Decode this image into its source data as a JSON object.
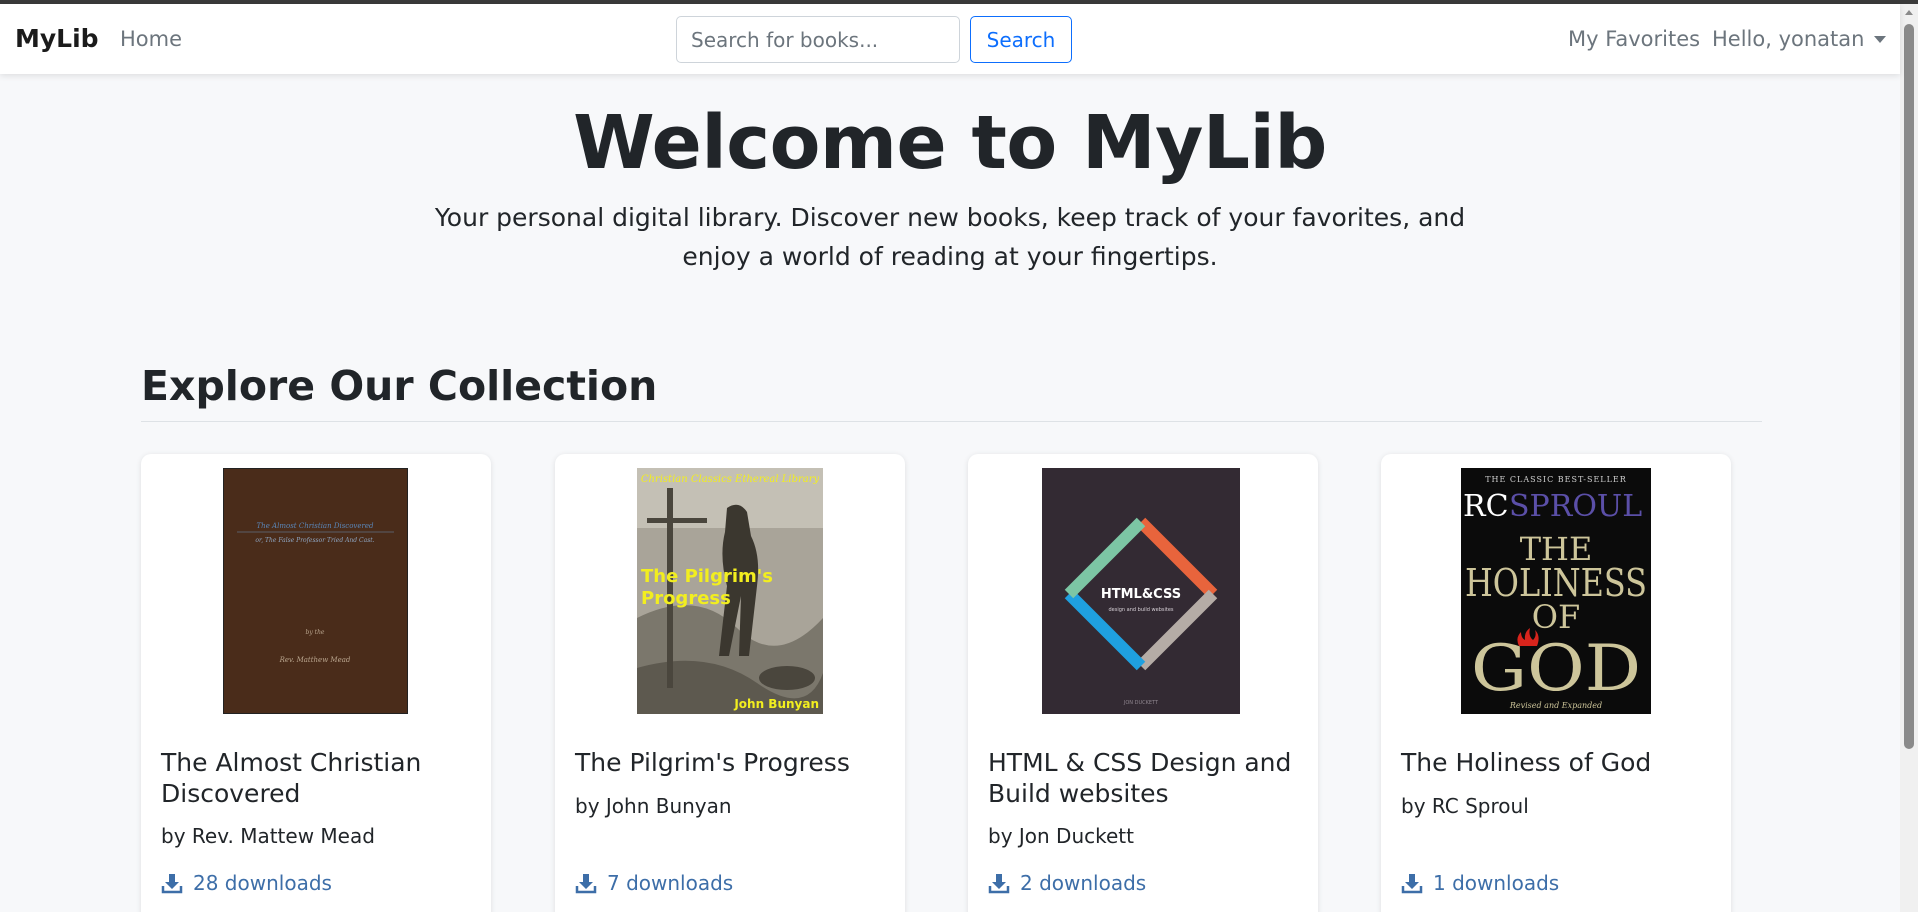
{
  "navbar": {
    "brand": "MyLib",
    "home_label": "Home",
    "search_placeholder": "Search for books...",
    "search_button": "Search",
    "favorites_label": "My Favorites",
    "user_greeting": "Hello, yonatan"
  },
  "hero": {
    "title": "Welcome to MyLib",
    "subtitle": "Your personal digital library. Discover new books, keep track of your favorites, and enjoy a world of reading at your fingertips."
  },
  "collection": {
    "heading": "Explore Our Collection",
    "books": [
      {
        "title": "The Almost Christian Discovered",
        "author": "by Rev. Mattew Mead",
        "downloads": "28 downloads",
        "cover": {
          "line1": "The Almost Christian Discovered",
          "line2": "or, The False Professor Tried And Cast.",
          "byline": "by the",
          "name": "Rev. Matthew Mead",
          "bg": "#4a2c1a"
        }
      },
      {
        "title": "The Pilgrim's Progress",
        "author": "by John Bunyan",
        "downloads": "7 downloads",
        "cover": {
          "series": "Christian Classics Ethereal Library",
          "title": "The Pilgrim's Progress",
          "author": "John Bunyan",
          "text_color": "#f2ee1f"
        }
      },
      {
        "title": "HTML & CSS Design and Build websites",
        "author": "by Jon Duckett",
        "downloads": "2 downloads",
        "cover": {
          "title_a": "HTML",
          "amp": "&",
          "title_b": "CSS",
          "subtitle": "design and build websites",
          "author": "JON DUCKETT",
          "bg": "#332a33"
        }
      },
      {
        "title": "The Holiness of God",
        "author": "by RC Sproul",
        "downloads": "1 downloads",
        "cover": {
          "top": "THE CLASSIC BEST-SELLER",
          "author_a": "RC",
          "author_b": "SPROUL",
          "t1": "THE",
          "t2": "HOLINESS",
          "t3": "OF",
          "t4": "GOD",
          "bottom": "Revised and Expanded"
        }
      }
    ]
  },
  "colors": {
    "primary": "#0d6efd",
    "download_link": "#3d6ea8",
    "page_bg": "#f7f8fa"
  },
  "icons": {
    "download": "download-icon",
    "caret": "chevron-down-icon"
  }
}
